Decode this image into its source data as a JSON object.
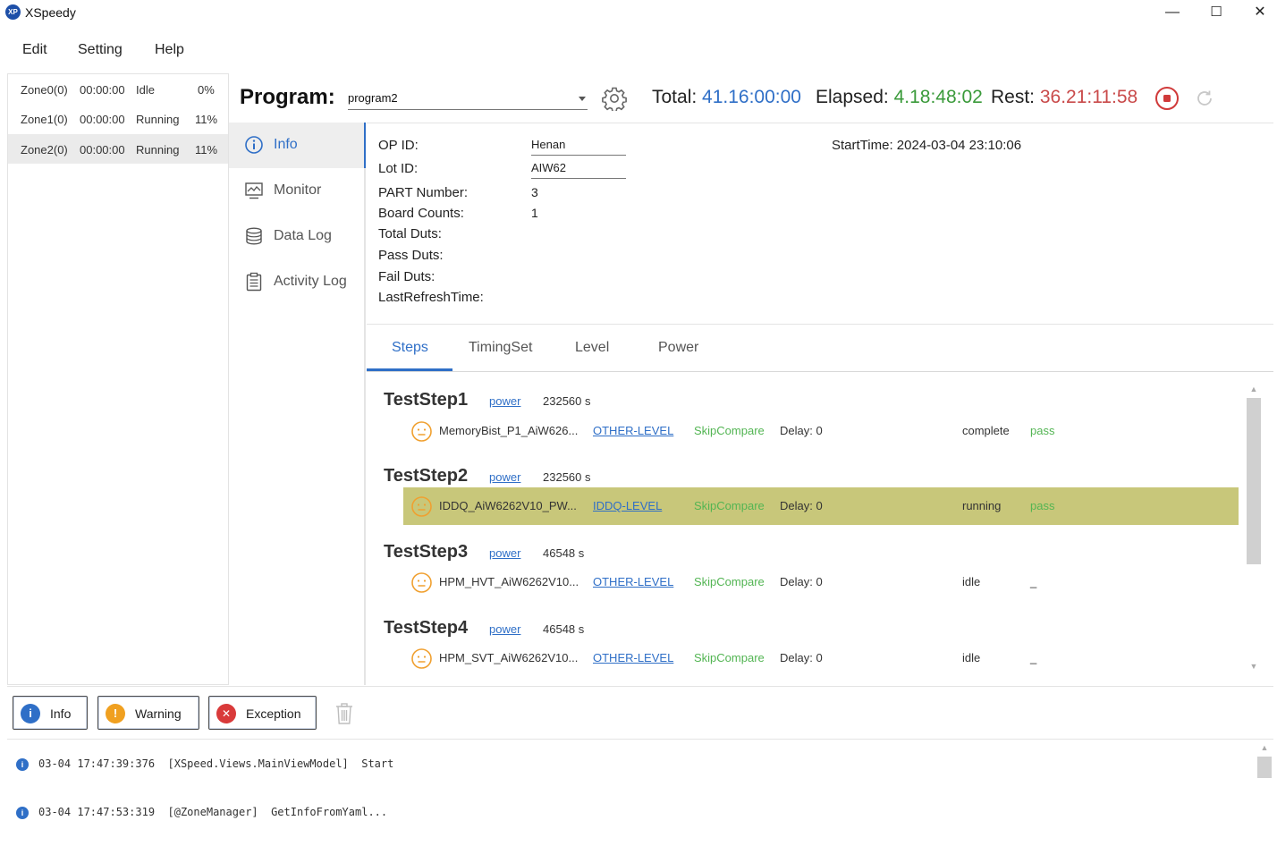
{
  "window": {
    "logo_text": "XP",
    "title": "XSpeedy",
    "minimize": "—",
    "maximize": "☐",
    "close": "✕"
  },
  "menu": [
    "Edit",
    "Setting",
    "Help"
  ],
  "zones": [
    {
      "name": "Zone0(0)",
      "time": "00:00:00",
      "status": "Idle",
      "progress": "0%"
    },
    {
      "name": "Zone1(0)",
      "time": "00:00:00",
      "status": "Running",
      "progress": "11%"
    },
    {
      "name": "Zone2(0)",
      "time": "00:00:00",
      "status": "Running",
      "progress": "11%"
    }
  ],
  "header": {
    "program_label": "Program:",
    "program_value": "program2",
    "total_label": "Total:",
    "total_value": "41.16:00:00",
    "elapsed_label": "Elapsed:",
    "elapsed_value": "4.18:48:02",
    "rest_label": "Rest:",
    "rest_value": "36.21:11:58",
    "colors": {
      "total": "#2f6fc7",
      "elapsed": "#3a9a3a",
      "rest": "#c94a4a"
    }
  },
  "nav": [
    {
      "label": "Info",
      "icon": "info-icon"
    },
    {
      "label": "Monitor",
      "icon": "monitor-icon"
    },
    {
      "label": "Data Log",
      "icon": "database-icon"
    },
    {
      "label": "Activity Log",
      "icon": "clipboard-icon"
    }
  ],
  "info": {
    "op_id_label": "OP ID:",
    "op_id_value": "Henan",
    "lot_id_label": "Lot ID:",
    "lot_id_value": "AIW62",
    "part_number_label": "PART Number:",
    "part_number_value": "3",
    "board_counts_label": "Board Counts:",
    "board_counts_value": "1",
    "total_duts_label": "Total Duts:",
    "pass_duts_label": "Pass Duts:",
    "fail_duts_label": "Fail Duts:",
    "last_refresh_label": "LastRefreshTime:",
    "start_time": "StartTime: 2024-03-04 23:10:06"
  },
  "tabs": [
    "Steps",
    "TimingSet",
    "Level",
    "Power"
  ],
  "steps": [
    {
      "title": "TestStep1",
      "power": "power",
      "time": "232560 s",
      "item": {
        "name": "MemoryBist_P1_AiW626...",
        "level": "OTHER-LEVEL",
        "skip": "SkipCompare",
        "delay": "Delay: 0",
        "state": "complete",
        "result": "pass"
      }
    },
    {
      "title": "TestStep2",
      "power": "power",
      "time": "232560 s",
      "item": {
        "name": "IDDQ_AiW6262V10_PW...",
        "level": "IDDQ-LEVEL",
        "skip": "SkipCompare",
        "delay": "Delay: 0",
        "state": "running",
        "result": "pass"
      }
    },
    {
      "title": "TestStep3",
      "power": "power",
      "time": "46548 s",
      "item": {
        "name": "HPM_HVT_AiW6262V10...",
        "level": "OTHER-LEVEL",
        "skip": "SkipCompare",
        "delay": "Delay: 0",
        "state": "idle",
        "result": "_"
      }
    },
    {
      "title": "TestStep4",
      "power": "power",
      "time": "46548 s",
      "item": {
        "name": "HPM_SVT_AiW6262V10...",
        "level": "OTHER-LEVEL",
        "skip": "SkipCompare",
        "delay": "Delay: 0",
        "state": "idle",
        "result": "_"
      }
    }
  ],
  "log_filters": [
    {
      "label": "Info",
      "icon": "info-icon",
      "glyph": "i",
      "color": "#2f6fc7"
    },
    {
      "label": "Warning",
      "icon": "warning-icon",
      "glyph": "!",
      "color": "#f0a020"
    },
    {
      "label": "Exception",
      "icon": "error-icon",
      "glyph": "✕",
      "color": "#d93a3a"
    }
  ],
  "logs": [
    "03-04 17:47:39:376  [XSpeed.Views.MainViewModel]  Start",
    "03-04 17:47:53:319  [@ZoneManager]  GetInfoFromYaml..."
  ]
}
